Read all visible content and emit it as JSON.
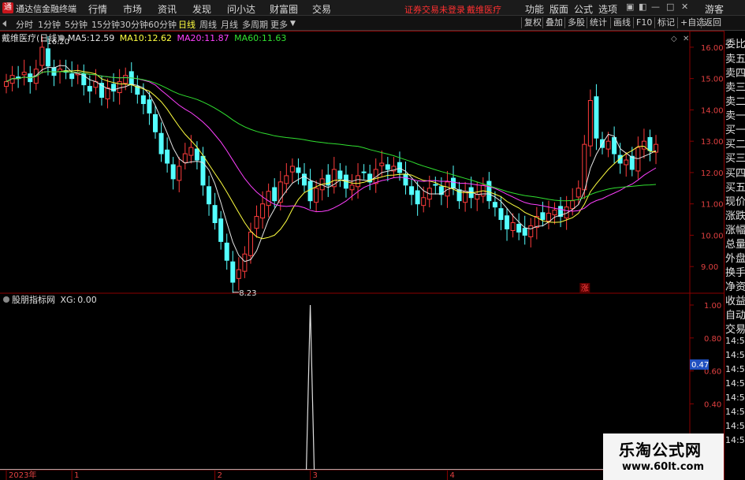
{
  "app": {
    "title": "通达信金融终端",
    "menu": [
      "行情",
      "市场",
      "资讯",
      "发现",
      "问小达",
      "财富圈",
      "交易"
    ],
    "warning": "证券交易未登录",
    "stock_name": "戴维医疗",
    "right_menu": [
      "功能",
      "版面",
      "公式",
      "选项"
    ],
    "user": "游客"
  },
  "toolbar": {
    "periods": [
      "分时",
      "1分钟",
      "5分钟",
      "15分钟",
      "30分钟",
      "60分钟",
      "日线",
      "周线",
      "月线",
      "多周期",
      "更多"
    ],
    "active_period": "日线",
    "buttons": [
      "复权",
      "叠加",
      "多股",
      "统计",
      "画线",
      "F10",
      "标记",
      "+自选",
      "返回"
    ]
  },
  "main_panel": {
    "title": "戴维医疗(日线)",
    "ma": [
      {
        "label": "MA5:",
        "value": "12.59",
        "color": "#e6e6e6"
      },
      {
        "label": "MA10:",
        "value": "12.62",
        "color": "#ffff40"
      },
      {
        "label": "MA20:",
        "value": "11.87",
        "color": "#ff40ff"
      },
      {
        "label": "MA60:",
        "value": "11.63",
        "color": "#30e030"
      }
    ],
    "high_label": "16.20",
    "low_label": "8.23",
    "zhang_mark": "涨"
  },
  "indicator": {
    "name": "股朋指标网",
    "formula": "XG:",
    "value": "0.00",
    "current_label": "0.47"
  },
  "side_panel": {
    "items": [
      "委比",
      "卖五",
      "卖四",
      "卖三",
      "卖二",
      "卖一",
      "买一",
      "买二",
      "买三",
      "买四",
      "买五",
      "现价",
      "涨跌",
      "涨幅",
      "总量",
      "外盘",
      "换手",
      "净资",
      "收益",
      "自动",
      "交易",
      "14:56",
      "14:56",
      "14:56",
      "14:56",
      "14:56",
      "14:56",
      "14:56",
      "14:56"
    ]
  },
  "watermark": {
    "title": "乐淘公式网",
    "url": "www.60lt.com"
  },
  "chart_data": {
    "type": "candlestick",
    "y_axis_main": {
      "range": [
        8.2,
        16.4
      ],
      "ticks": [
        "16.00",
        "15.00",
        "14.00",
        "13.00",
        "12.00",
        "11.00",
        "10.00",
        "9.00"
      ]
    },
    "y_axis_indicator": {
      "range": [
        0,
        1.0
      ],
      "ticks": [
        "1.00",
        "0.80",
        "0.60",
        "0.40",
        "0.20"
      ]
    },
    "x_labels": [
      {
        "label": "2023年",
        "index": 0
      },
      {
        "label": "1",
        "index": 11
      },
      {
        "label": "2",
        "index": 35
      },
      {
        "label": "3",
        "index": 51
      },
      {
        "label": "4",
        "index": 74
      }
    ],
    "high": {
      "value": 16.2,
      "index": 6
    },
    "low": {
      "value": 8.23,
      "index": 38
    },
    "zhang_index": 97,
    "closes": [
      14.9,
      15.1,
      15.0,
      15.2,
      14.9,
      15.3,
      16.0,
      15.4,
      15.1,
      15.3,
      15.2,
      15.0,
      15.2,
      14.8,
      14.6,
      14.9,
      14.4,
      14.7,
      14.6,
      14.9,
      15.1,
      14.8,
      14.5,
      14.2,
      13.9,
      13.3,
      12.6,
      12.3,
      11.8,
      12.2,
      12.6,
      12.8,
      12.4,
      11.6,
      11.0,
      10.4,
      9.8,
      9.2,
      8.5,
      8.9,
      9.4,
      10.1,
      10.6,
      11.0,
      11.4,
      11.1,
      11.7,
      11.9,
      12.2,
      12.0,
      11.6,
      11.1,
      11.5,
      11.8,
      11.6,
      12.1,
      11.8,
      11.5,
      11.6,
      11.9,
      12.0,
      11.7,
      12.1,
      12.3,
      12.1,
      12.2,
      12.0,
      11.6,
      11.3,
      11.0,
      11.2,
      11.5,
      11.6,
      11.3,
      11.7,
      11.5,
      11.1,
      11.4,
      11.2,
      11.3,
      11.6,
      11.1,
      10.9,
      10.5,
      10.2,
      10.4,
      10.1,
      10.0,
      10.3,
      10.6,
      10.5,
      10.7,
      10.8,
      10.6,
      10.9,
      11.1,
      11.5,
      12.9,
      14.3,
      13.1,
      12.8,
      13.0,
      12.6,
      12.3,
      12.4,
      12.1,
      12.8,
      13.0,
      12.7,
      12.9
    ],
    "ma_periods": [
      5,
      10,
      20,
      60
    ],
    "xg_spike": {
      "index": 51,
      "value": 1.0
    },
    "indicator_current": 0.47
  }
}
